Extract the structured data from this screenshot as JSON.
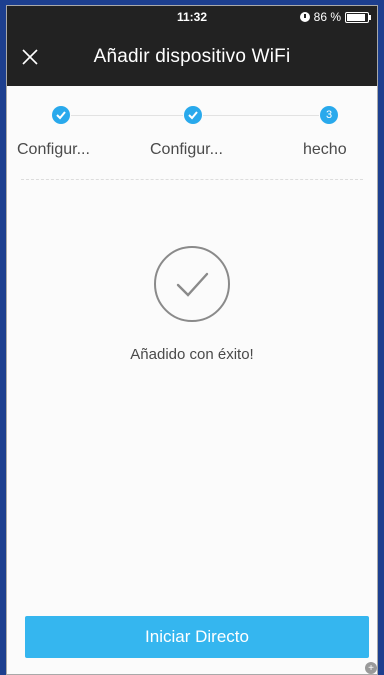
{
  "status_bar": {
    "time": "11:32",
    "battery_text": "86 %",
    "icons": [
      "alarm-icon",
      "battery-icon"
    ]
  },
  "header": {
    "title": "Añadir dispositivo WiFi",
    "close_icon": "close-icon"
  },
  "steps": [
    {
      "label": "Configur...",
      "state": "done",
      "icon": "check-icon"
    },
    {
      "label": "Configur...",
      "state": "done",
      "icon": "check-icon"
    },
    {
      "label": "hecho",
      "state": "current",
      "number": "3"
    }
  ],
  "result": {
    "icon": "checkmark-circle-icon",
    "message": "Añadido con éxito!"
  },
  "footer": {
    "button_label": "Iniciar Directo"
  },
  "colors": {
    "accent": "#35b6ef",
    "step_blue": "#29a9ec",
    "header_bg": "#222222",
    "frame_blue": "#1d3f8f"
  }
}
